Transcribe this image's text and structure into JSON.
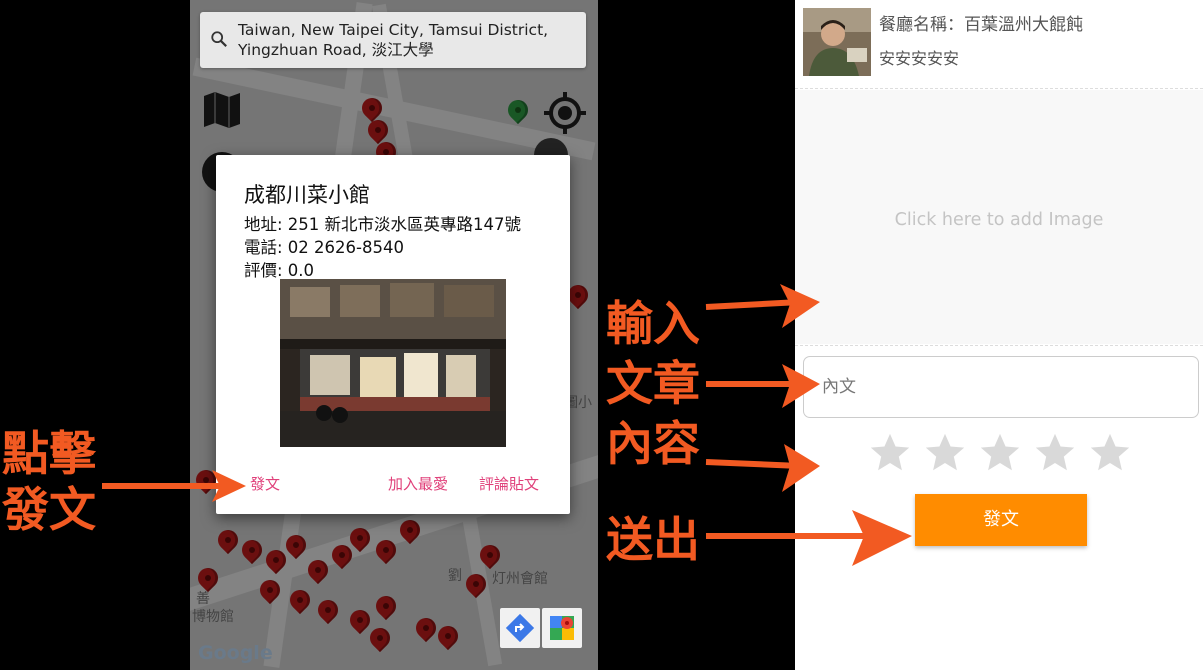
{
  "map": {
    "search_text": "Taiwan, New Taipei City, Tamsui District, Yingzhuan Road, 淡江大學",
    "labels": [
      "圖小",
      "劉",
      "灯州會館",
      "善",
      "博物館"
    ],
    "google": "Google"
  },
  "dialog": {
    "title": "成都川菜小館",
    "address": "地址: 251 新北市淡水區英專路147號",
    "phone": "電話: 02 2626-8540",
    "rating": "評價: 0.0",
    "post_label": "發文",
    "favorite_label": "加入最愛",
    "comments_label": "評論貼文"
  },
  "post_form": {
    "restaurant_name": "餐廳名稱：百葉溫州大餛飩",
    "user_name": "安安安安安",
    "image_hint": "Click here to add Image",
    "content_placeholder": "內文",
    "rating_stars": 0,
    "submit_label": "發文"
  },
  "annotations": {
    "click_post_line1": "點擊",
    "click_post_line2": "發文",
    "input_line1": "輸入",
    "input_line2": "文章",
    "input_line3": "內容",
    "send": "送出"
  },
  "colors": {
    "annotation": "#f25a22",
    "accent_pink": "#e0407a",
    "submit_orange": "#ff8c00",
    "star_gray": "#d9d9d9"
  }
}
